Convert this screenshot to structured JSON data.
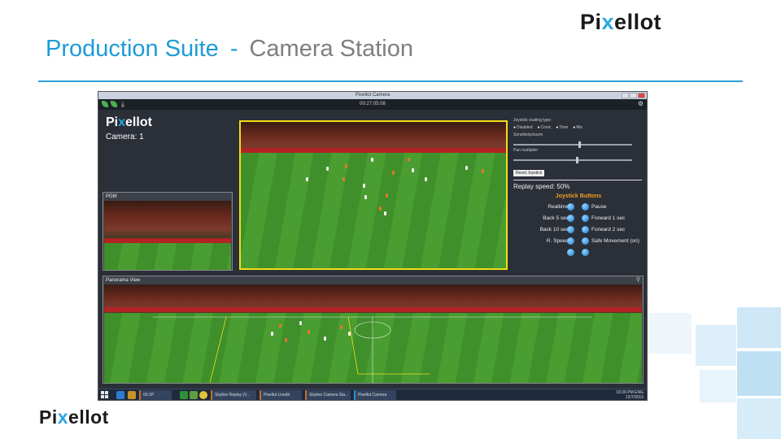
{
  "brand": {
    "logo_left": "Pi",
    "logo_x": "x",
    "logo_right": "ellot"
  },
  "slide": {
    "title_main": "Production Suite",
    "title_separator": "-",
    "title_sub": "Camera Station",
    "accent_color": "#1e9bd7"
  },
  "app": {
    "window_title": "Pixellot Camera",
    "clock": "00:27:05:08",
    "toolbar_icons": [
      "leaf-icon",
      "leaf-icon",
      "download-icon",
      "gear-icon"
    ],
    "camera_label": "Camera: 1",
    "pgm_label": "PGM",
    "panorama_label": "Panorama View",
    "controls": {
      "joystick_label": "Joystick scaling type:",
      "scaling_options": [
        "Disabled",
        "Conic",
        "Time",
        "Mix"
      ],
      "slider1_label": "Sensitivity/zoom",
      "slider1_level": 0.55,
      "slider2_label": "Pan multiplier",
      "slider2_level": 0.53,
      "reset_button": "Reset Joystick",
      "replay_speed": "Replay speed: 50%",
      "joystick_title": "Joystick Buttons",
      "left_buttons": [
        "Realtime",
        "Back 5 sec",
        "Back 10 sec",
        "R. Speed",
        ""
      ],
      "right_buttons": [
        "Pause",
        "Forward 1 sec",
        "Forward 2 sec",
        "Safe Movement (on)",
        ""
      ],
      "button_color": "#1976d2"
    },
    "taskbar": {
      "tasks": [
        "00:1P",
        "Skyline Replay (V...",
        "Pixellot Livedit",
        "Skyline Camera Sta...",
        "Pixellot Camera"
      ],
      "tray_line1": "10:26 PM",
      "tray_line2": "ENG",
      "tray_date": "12/7/2015"
    }
  }
}
